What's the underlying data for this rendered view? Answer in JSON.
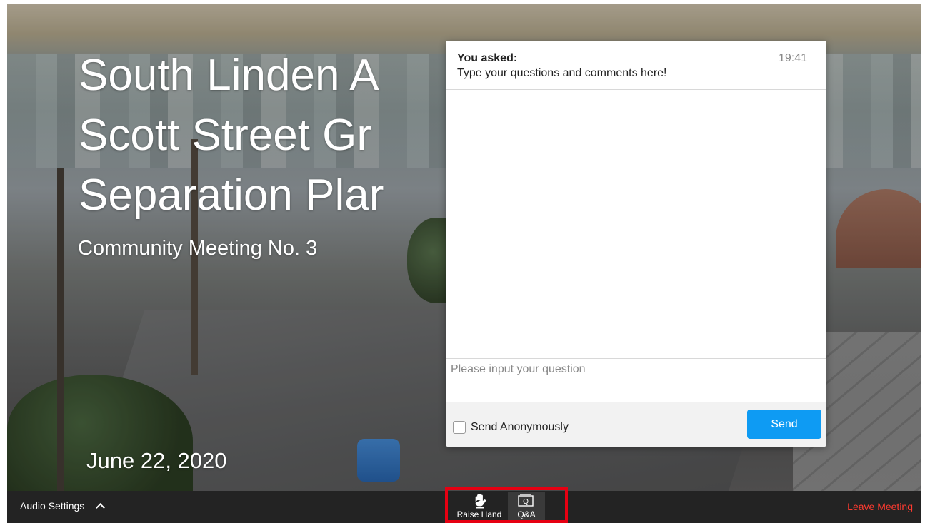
{
  "slide": {
    "title_line1": "South Linden A",
    "title_line2": "Scott Street Gr",
    "title_line3": "Separation Plar",
    "subtitle": "Community Meeting No. 3",
    "date": "June 22, 2020"
  },
  "qa": {
    "asked_label": "You asked:",
    "asked_message": "Type your questions and comments here!",
    "asked_time": "19:41",
    "input_placeholder": "Please input your question",
    "anonymous_label": "Send Anonymously",
    "send_label": "Send",
    "accent_color": "#0e9bf3"
  },
  "toolbar": {
    "audio_settings_label": "Audio Settings",
    "raise_hand_label": "Raise Hand",
    "qa_label": "Q&A",
    "leave_label": "Leave Meeting",
    "leave_color": "#ff3b30",
    "highlight_color": "#e60012",
    "icons": [
      "chevron-up-icon",
      "raise-hand-icon",
      "qa-icon"
    ]
  }
}
